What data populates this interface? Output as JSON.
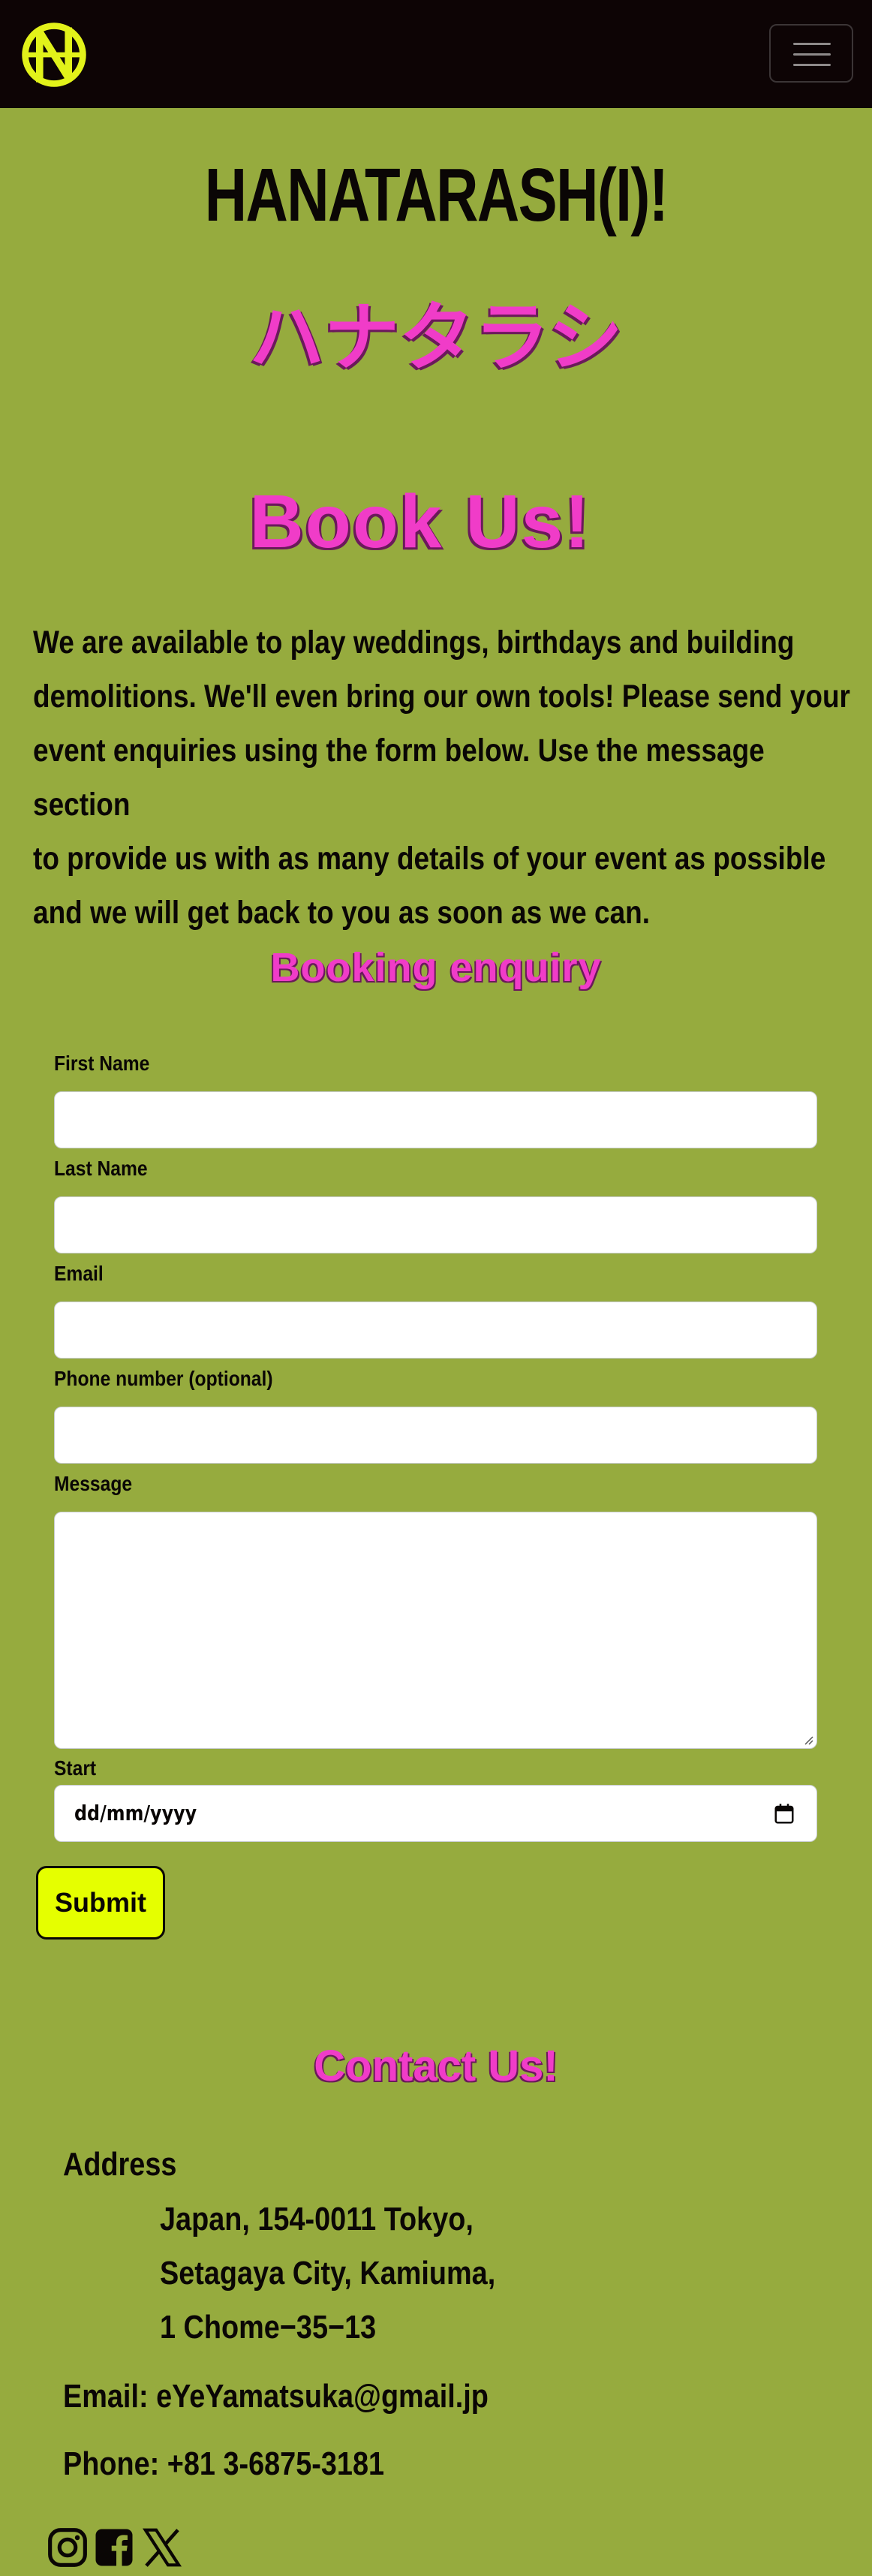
{
  "colors": {
    "background": "#96ab3e",
    "navbar": "#0d0405",
    "logo": "#e2f21a",
    "heading_pink": "#f03cc8",
    "submit_yellow": "#e5ff00"
  },
  "navbar": {
    "logo_icon": "hanatarashi-logo-icon",
    "menu_icon": "hamburger-menu-icon"
  },
  "header": {
    "band_name": "HANATARASH(I)!",
    "katakana": "ハナタラシ"
  },
  "book": {
    "title": "Book Us!",
    "intro_lines": [
      "We are available to play weddings, birthdays and building",
      "demolitions. We'll even bring our own tools! Please send your",
      "event enquiries using the form below. Use the message section",
      "to provide us with as many details of your event as possible",
      "and we will get back to you as soon as we can."
    ]
  },
  "form": {
    "title": "Booking enquiry",
    "first_name_label": "First Name",
    "first_name_value": "",
    "last_name_label": "Last Name",
    "last_name_value": "",
    "email_label": "Email",
    "email_value": "",
    "phone_label": "Phone number (optional)",
    "phone_value": "",
    "message_label": "Message",
    "message_value": "",
    "start_label": "Start",
    "start_placeholder": "dd/mm/yyyy",
    "calendar_icon": "calendar-icon",
    "submit_label": "Submit"
  },
  "contact": {
    "title": "Contact Us!",
    "address_label": "Address",
    "address_lines": [
      "Japan, 154-0011 Tokyo,",
      "Setagaya City, Kamiuma,",
      "1 Chome−35−13"
    ],
    "email": "Email: eYeYamatsuka@gmail.jp",
    "phone": "Phone: +81 3-6875-3181"
  },
  "social": {
    "icons": [
      "instagram-icon",
      "facebook-icon",
      "x-twitter-icon"
    ]
  }
}
